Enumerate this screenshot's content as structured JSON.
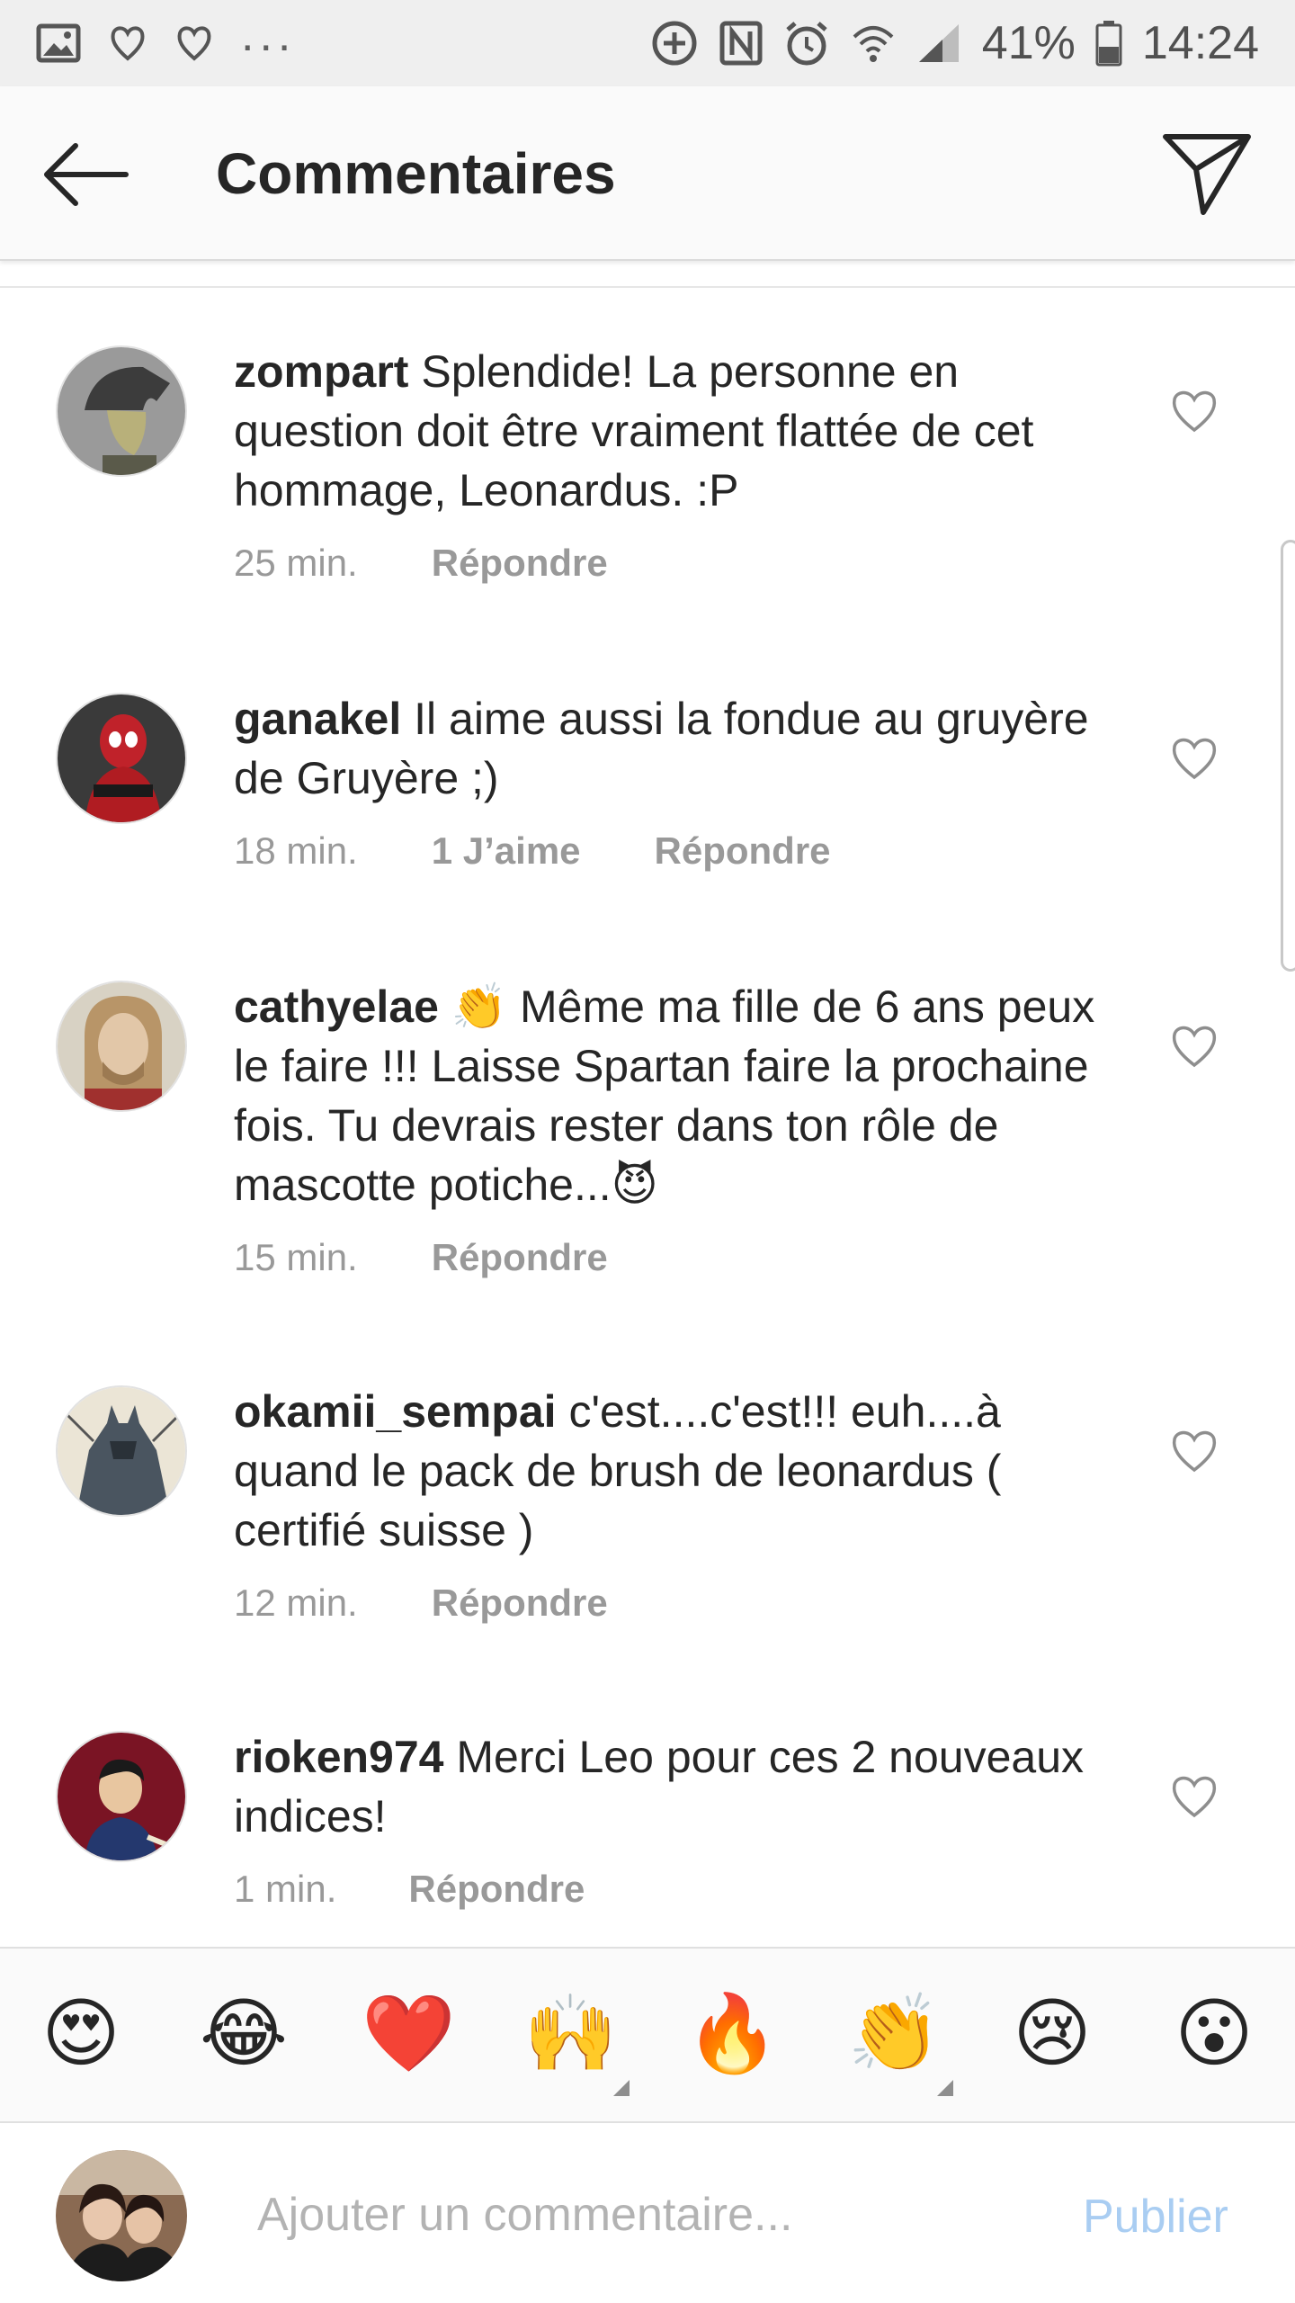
{
  "status_bar": {
    "battery": "41%",
    "time": "14:24",
    "dots": "...",
    "icons_left": [
      "image-icon",
      "heart-outline-icon",
      "heart-outline-icon"
    ],
    "icons_right": [
      "data-saver-icon",
      "nfc-icon",
      "alarm-icon",
      "wifi-icon",
      "signal-icon",
      "battery-icon"
    ]
  },
  "header": {
    "title": "Commentaires",
    "back_icon": "arrow-left-icon",
    "share_icon": "paper-plane-icon"
  },
  "comments": [
    {
      "username": "zompart",
      "text": "Splendide! La personne en question doit être vraiment flattée de cet hommage, Leonardus. :P",
      "time": "25 min.",
      "likes": "",
      "reply": "Répondre"
    },
    {
      "username": "ganakel",
      "text": "Il aime aussi la fondue au gruyère de Gruyère ;)",
      "time": "18 min.",
      "likes": "1 J’aime",
      "reply": "Répondre"
    },
    {
      "username": "cathyelae",
      "text": "👏 Même ma fille de 6 ans peux le faire !!! Laisse  Spartan faire la prochaine fois. Tu devrais rester dans ton rôle de mascotte potiche...😈",
      "time": "15 min.",
      "likes": "",
      "reply": "Répondre"
    },
    {
      "username": "okamii_sempai",
      "text": "c'est....c'est!!! euh....à quand le pack de brush de leonardus ( certifié suisse )",
      "time": "12 min.",
      "likes": "",
      "reply": "Répondre"
    },
    {
      "username": "rioken974",
      "text": "Merci Leo pour ces 2 nouveaux indices!",
      "time": "1 min.",
      "likes": "",
      "reply": "Répondre"
    }
  ],
  "emoji_bar": [
    "😍",
    "😂",
    "❤️",
    "🙌",
    "🔥",
    "👏",
    "😢",
    "😮"
  ],
  "input": {
    "placeholder": "Ajouter un commentaire...",
    "value": "",
    "publish_label": "Publier"
  },
  "colors": {
    "text": "#262626",
    "meta": "#999999",
    "publish_disabled": "#a9cdf2",
    "header_bg": "#fafafa"
  }
}
